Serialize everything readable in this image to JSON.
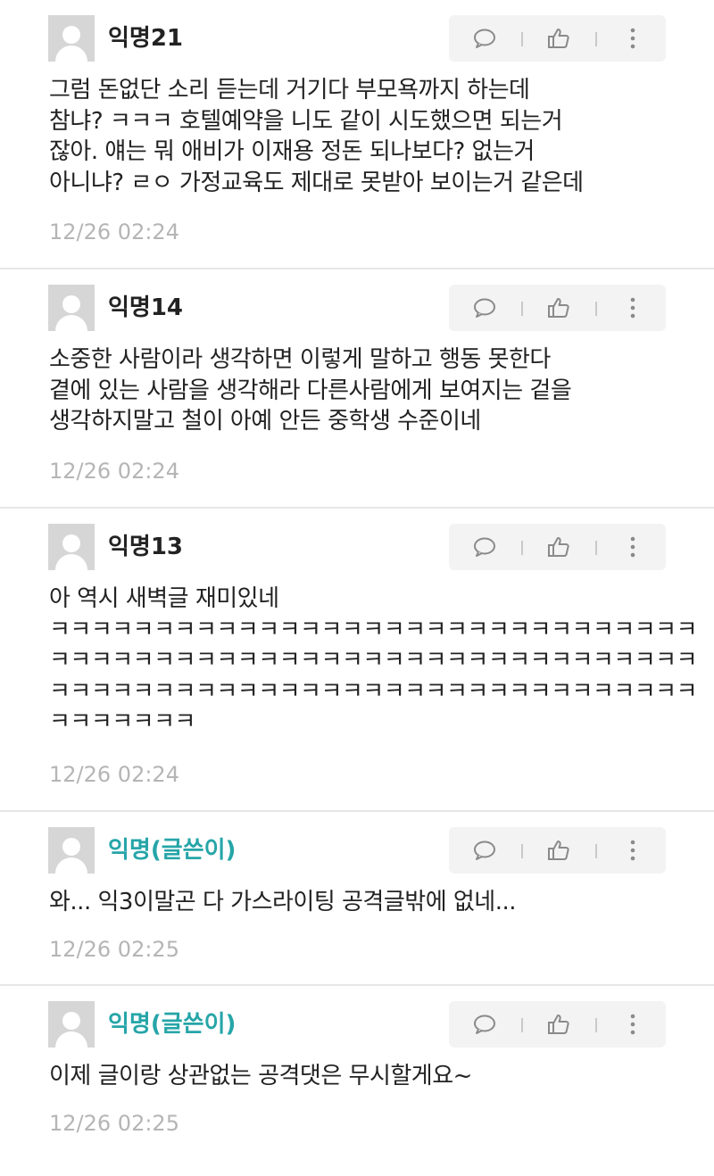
{
  "comments": [
    {
      "author": "익명21",
      "is_op": false,
      "lines": [
        "그럼 돈없단 소리 듣는데 거기다 부모욕까지 하는데",
        "참냐? ㅋㅋㅋ 호텔예약을 니도 같이 시도했으면 되는거",
        "잖아. 얘는 뭐 애비가 이재용 정돈 되나보다? 없는거",
        "아니냐? ㄹㅇ 가정교육도 제대로 못받아 보이는거 같은데"
      ],
      "date": "12/26 02:24"
    },
    {
      "author": "익명14",
      "is_op": false,
      "lines": [
        "소중한 사람이라 생각하면 이렇게 말하고 행동 못한다",
        "곁에 있는 사람을 생각해라 다른사람에게 보여지는 겉을",
        "생각하지말고 철이 아예 안든 중학생 수준이네"
      ],
      "date": "12/26 02:24"
    },
    {
      "author": "익명13",
      "is_op": false,
      "lines": [
        "아 역시 새벽글 재미있네",
        "ㅋㅋㅋㅋㅋㅋㅋㅋㅋㅋㅋㅋㅋㅋㅋㅋㅋㅋㅋㅋㅋㅋㅋㅋㅋㅋㅋㅋㅋㅋㅋ",
        "ㅋㅋㅋㅋㅋㅋㅋㅋㅋㅋㅋㅋㅋㅋㅋㅋㅋㅋㅋㅋㅋㅋㅋㅋㅋㅋㅋㅋㅋㅋㅋ",
        "ㅋㅋㅋㅋㅋㅋㅋㅋㅋㅋㅋㅋㅋㅋㅋㅋㅋㅋㅋㅋㅋㅋㅋㅋㅋㅋㅋㅋㅋㅋㅋ",
        "ㅋㅋㅋㅋㅋㅋㅋ"
      ],
      "date": "12/26 02:24"
    },
    {
      "author": "익명(글쓴이)",
      "is_op": true,
      "lines": [
        "와... 익3이말곤 다 가스라이팅 공격글밖에 없네..."
      ],
      "date": "12/26 02:25"
    },
    {
      "author": "익명(글쓴이)",
      "is_op": true,
      "lines": [
        "이제 글이랑 상관없는 공격댓은 무시할게요~"
      ],
      "date": "12/26 02:25"
    }
  ],
  "icons": {
    "reply": "speech-bubble-icon",
    "like": "thumbs-up-icon",
    "more": "vertical-ellipsis-icon"
  },
  "colors": {
    "op_author": "#26a5a8",
    "date": "#b5b5b5",
    "action_bg": "#f3f3f3",
    "divider": "#e6e6e6"
  }
}
